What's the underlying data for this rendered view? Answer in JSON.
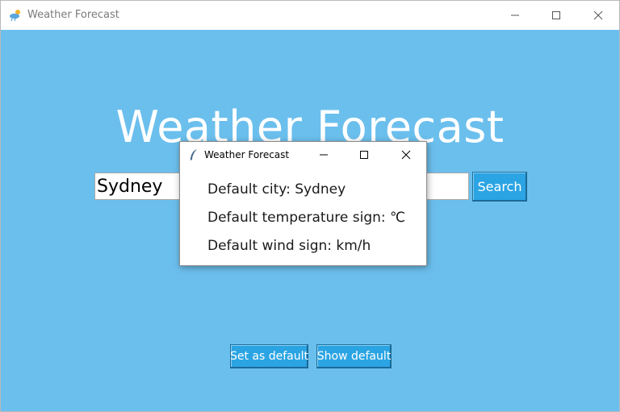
{
  "window": {
    "title": "Weather Forecast",
    "icon": "weather-cloud-icon",
    "controls": [
      "minimize-icon",
      "maximize-icon",
      "close-icon"
    ]
  },
  "main": {
    "heading": "Weather Forecast",
    "city_input_value": "Sydney",
    "search_label": "Search",
    "set_default_label": "Set as default",
    "show_default_label": "Show default",
    "background_color": "#6bbfed",
    "button_color": "#2ba4e3"
  },
  "popup": {
    "title": "Weather Forecast",
    "icon": "feather-icon",
    "lines": [
      "Default city: Sydney",
      "Default temperature sign: ℃",
      "Default wind sign: km/h"
    ]
  }
}
